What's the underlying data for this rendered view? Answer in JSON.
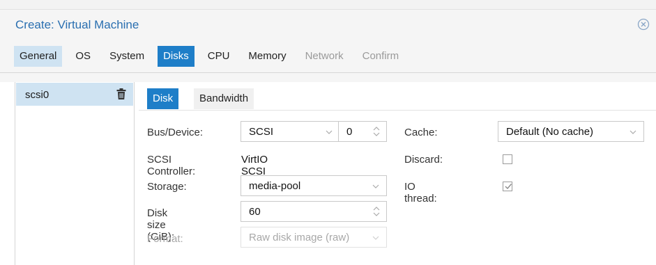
{
  "dialog": {
    "title": "Create: Virtual Machine",
    "close_icon": "close-circle-icon"
  },
  "tabs": [
    {
      "label": "General",
      "state": "selected"
    },
    {
      "label": "OS",
      "state": "normal"
    },
    {
      "label": "System",
      "state": "normal"
    },
    {
      "label": "Disks",
      "state": "active"
    },
    {
      "label": "CPU",
      "state": "normal"
    },
    {
      "label": "Memory",
      "state": "normal"
    },
    {
      "label": "Network",
      "state": "disabled"
    },
    {
      "label": "Confirm",
      "state": "disabled"
    }
  ],
  "disk_list": {
    "items": [
      {
        "label": "scsi0",
        "icon": "trash-icon"
      }
    ]
  },
  "disk_tabs": {
    "disk": "Disk",
    "bandwidth": "Bandwidth"
  },
  "form": {
    "bus_device_label": "Bus/Device:",
    "bus_value": "SCSI",
    "device_value": "0",
    "scsi_controller_label": "SCSI Controller:",
    "scsi_controller_value": "VirtIO SCSI single",
    "storage_label": "Storage:",
    "storage_value": "media-pool",
    "disk_size_label": "Disk size (GiB):",
    "disk_size_value": "60",
    "format_label": "Format:",
    "format_value": "Raw disk image (raw)",
    "cache_label": "Cache:",
    "cache_value": "Default (No cache)",
    "discard_label": "Discard:",
    "discard_checked": false,
    "io_thread_label": "IO thread:",
    "io_thread_checked": true
  },
  "colors": {
    "accent": "#1e7ec8",
    "title": "#2a6fb0",
    "selected_bg": "#cfe3f2"
  }
}
